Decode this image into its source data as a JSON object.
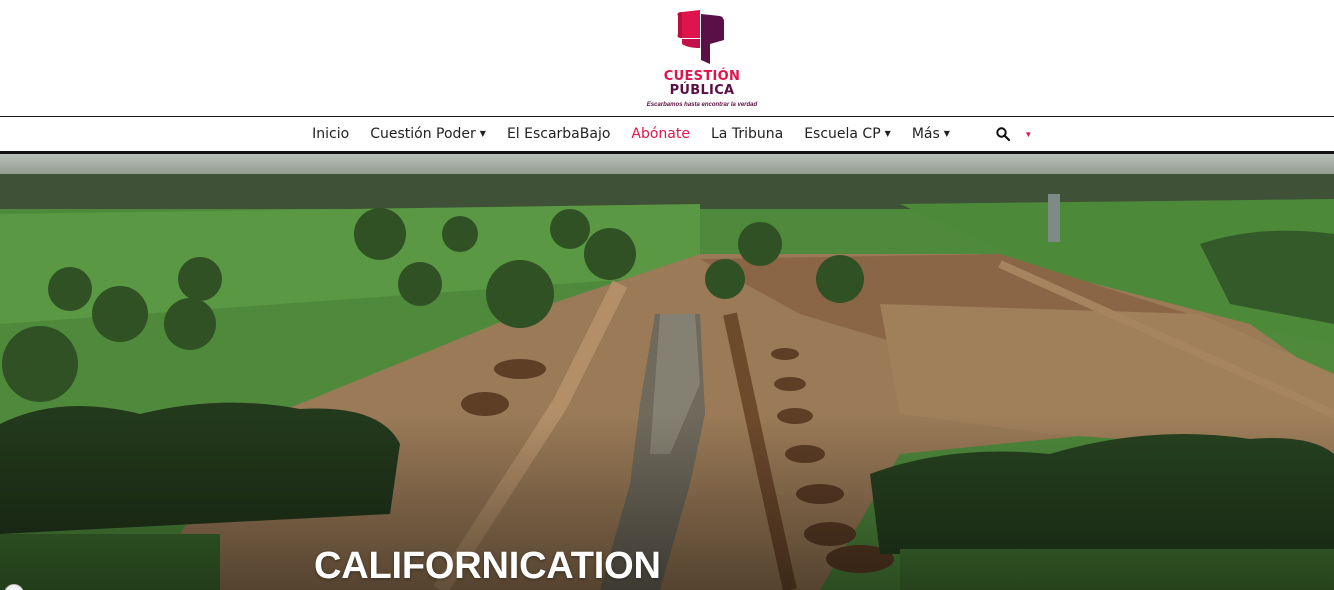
{
  "site": {
    "name_line1": "CUESTIÓN",
    "name_line2": "PÚBLICA",
    "tagline": "Escarbamos hasta encontrar la verdad",
    "logo_icon": "cuestion-publica-logo-icon",
    "colors": {
      "accent": "#e0144c",
      "secondary": "#5a1046",
      "nav_text": "#222222"
    }
  },
  "nav": {
    "items": [
      {
        "label": "Inicio",
        "dropdown": false
      },
      {
        "label": "Cuestión Poder",
        "dropdown": true
      },
      {
        "label": "El EscarbaBajo",
        "dropdown": false
      },
      {
        "label": "Abónate",
        "dropdown": false,
        "accent": true
      },
      {
        "label": "La Tribuna",
        "dropdown": false
      },
      {
        "label": "Escuela CP",
        "dropdown": true
      },
      {
        "label": "Más",
        "dropdown": true
      }
    ],
    "search_icon": "search-icon",
    "caret_icon": "chevron-down-icon"
  },
  "hero": {
    "title": "CALIFORNICATION",
    "image": "aerial-landscape-photo"
  }
}
